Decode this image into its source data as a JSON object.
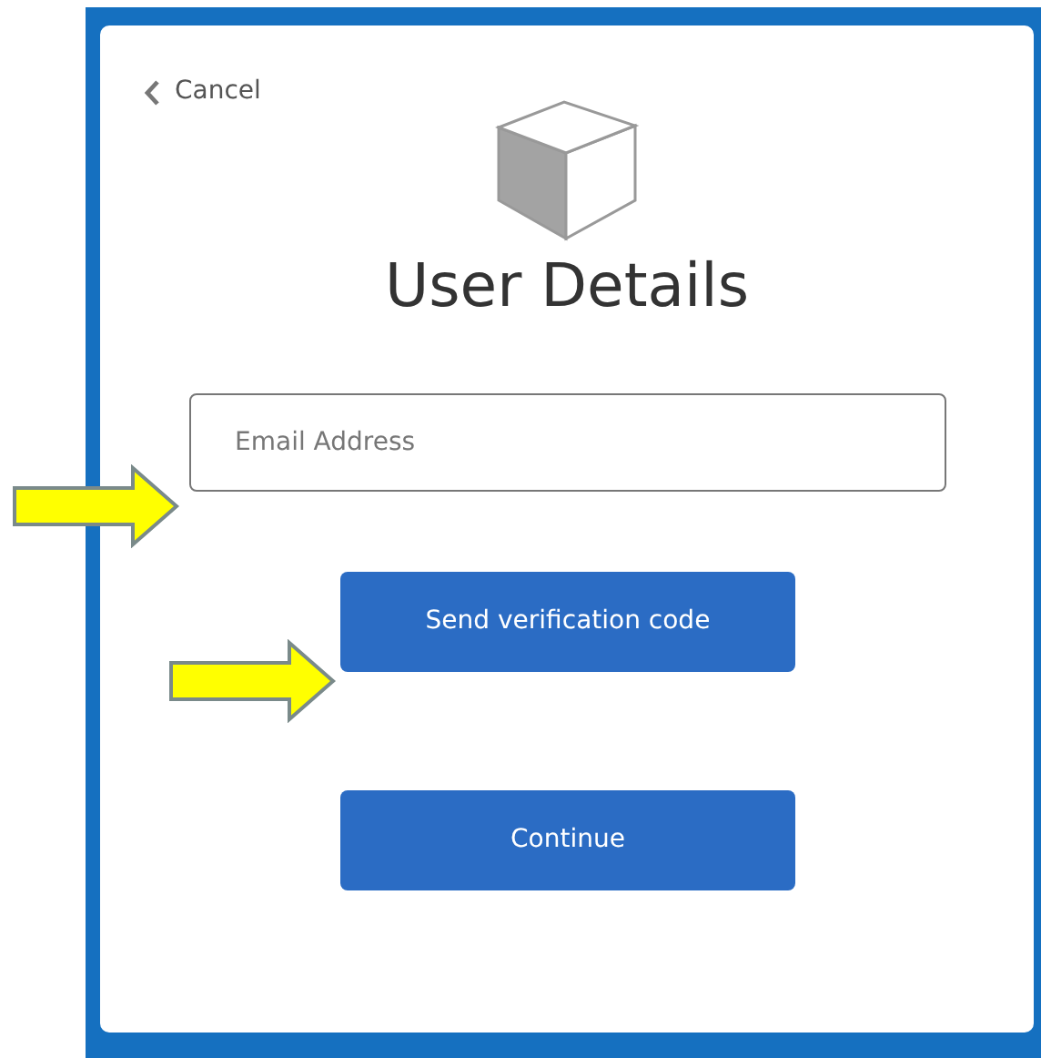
{
  "cancel_link": {
    "label": "Cancel"
  },
  "title": "User Details",
  "email_field": {
    "placeholder": "Email Address"
  },
  "buttons": [
    {
      "label": "Send verification code"
    },
    {
      "label": "Continue"
    }
  ]
}
